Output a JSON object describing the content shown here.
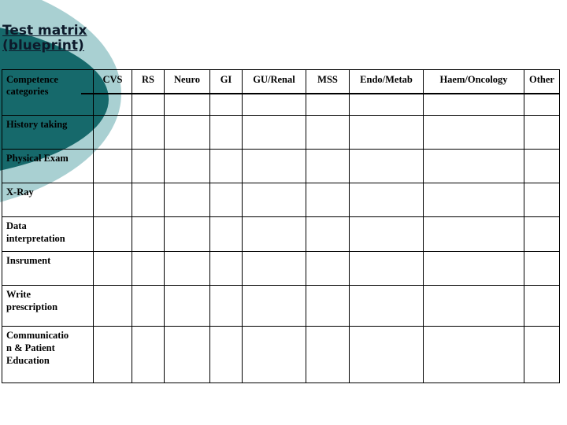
{
  "slide": {
    "title_lines": [
      "Test matrix",
      "(blueprint)"
    ],
    "background_color": "#ffffff"
  },
  "decoration": {
    "dark_teal": "#16696b",
    "light_teal": "#a9d0d2",
    "shape_dark_name": "dark-teal-semicircle",
    "shape_light_name": "light-teal-semicircle"
  },
  "matrix": {
    "corner_header_lines": [
      "Competence",
      "categories"
    ],
    "column_headers": [
      "CVS",
      "RS",
      "Neuro",
      "GI",
      "GU/Renal",
      "MSS",
      "Endo/Metab",
      "Haem/Oncology",
      "Other"
    ],
    "rows": [
      {
        "label_lines": [
          "History taking"
        ],
        "cells": [
          "",
          "",
          "",
          "",
          "",
          "",
          "",
          "",
          ""
        ]
      },
      {
        "label_lines": [
          "Physical Exam"
        ],
        "cells": [
          "",
          "",
          "",
          "",
          "",
          "",
          "",
          "",
          ""
        ]
      },
      {
        "label_lines": [
          "X-Ray"
        ],
        "cells": [
          "",
          "",
          "",
          "",
          "",
          "",
          "",
          "",
          ""
        ]
      },
      {
        "label_lines": [
          "Data",
          "interpretation"
        ],
        "cells": [
          "",
          "",
          "",
          "",
          "",
          "",
          "",
          "",
          ""
        ]
      },
      {
        "label_lines": [
          "Insrument"
        ],
        "cells": [
          "",
          "",
          "",
          "",
          "",
          "",
          "",
          "",
          ""
        ]
      },
      {
        "label_lines": [
          "Write",
          "prescription"
        ],
        "cells": [
          "",
          "",
          "",
          "",
          "",
          "",
          "",
          "",
          ""
        ]
      },
      {
        "label_lines": [
          "Communicatio",
          "n & Patient",
          "Education"
        ],
        "cells": [
          "",
          "",
          "",
          "",
          "",
          "",
          "",
          "",
          ""
        ]
      }
    ],
    "border_color": "#000000"
  }
}
